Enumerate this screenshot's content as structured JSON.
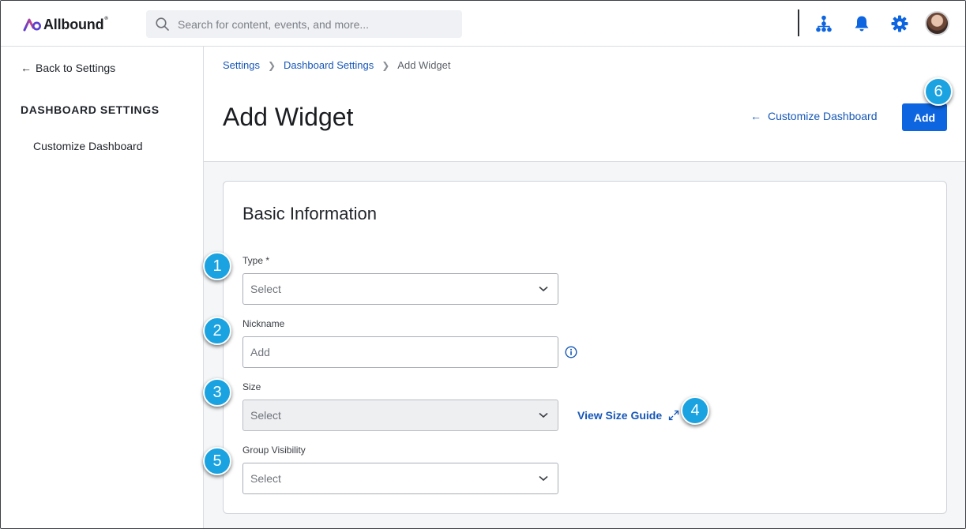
{
  "header": {
    "logo_text": "Allbound",
    "logo_mark": "®",
    "search": {
      "placeholder": "Search for content, events, and more..."
    },
    "icons": [
      "org-chart-icon",
      "bell-icon",
      "gear-icon",
      "user-avatar"
    ],
    "accent": "#0d65e0"
  },
  "sidebar": {
    "back_label": "Back to Settings",
    "heading": "DASHBOARD SETTINGS",
    "items": [
      {
        "label": "Customize Dashboard"
      }
    ]
  },
  "breadcrumb": {
    "items": [
      "Settings",
      "Dashboard Settings"
    ],
    "current": "Add Widget"
  },
  "page": {
    "title": "Add Widget",
    "customize_link": "Customize Dashboard",
    "add_label": "Add"
  },
  "form": {
    "section_title": "Basic Information",
    "type": {
      "label": "Type *",
      "value": "Select"
    },
    "nickname": {
      "label": "Nickname",
      "placeholder": "Add"
    },
    "size": {
      "label": "Size",
      "value": "Select",
      "guide_link": "View Size Guide"
    },
    "group_visibility": {
      "label": "Group Visibility",
      "value": "Select"
    }
  },
  "callouts": [
    "1",
    "2",
    "3",
    "4",
    "5",
    "6"
  ]
}
